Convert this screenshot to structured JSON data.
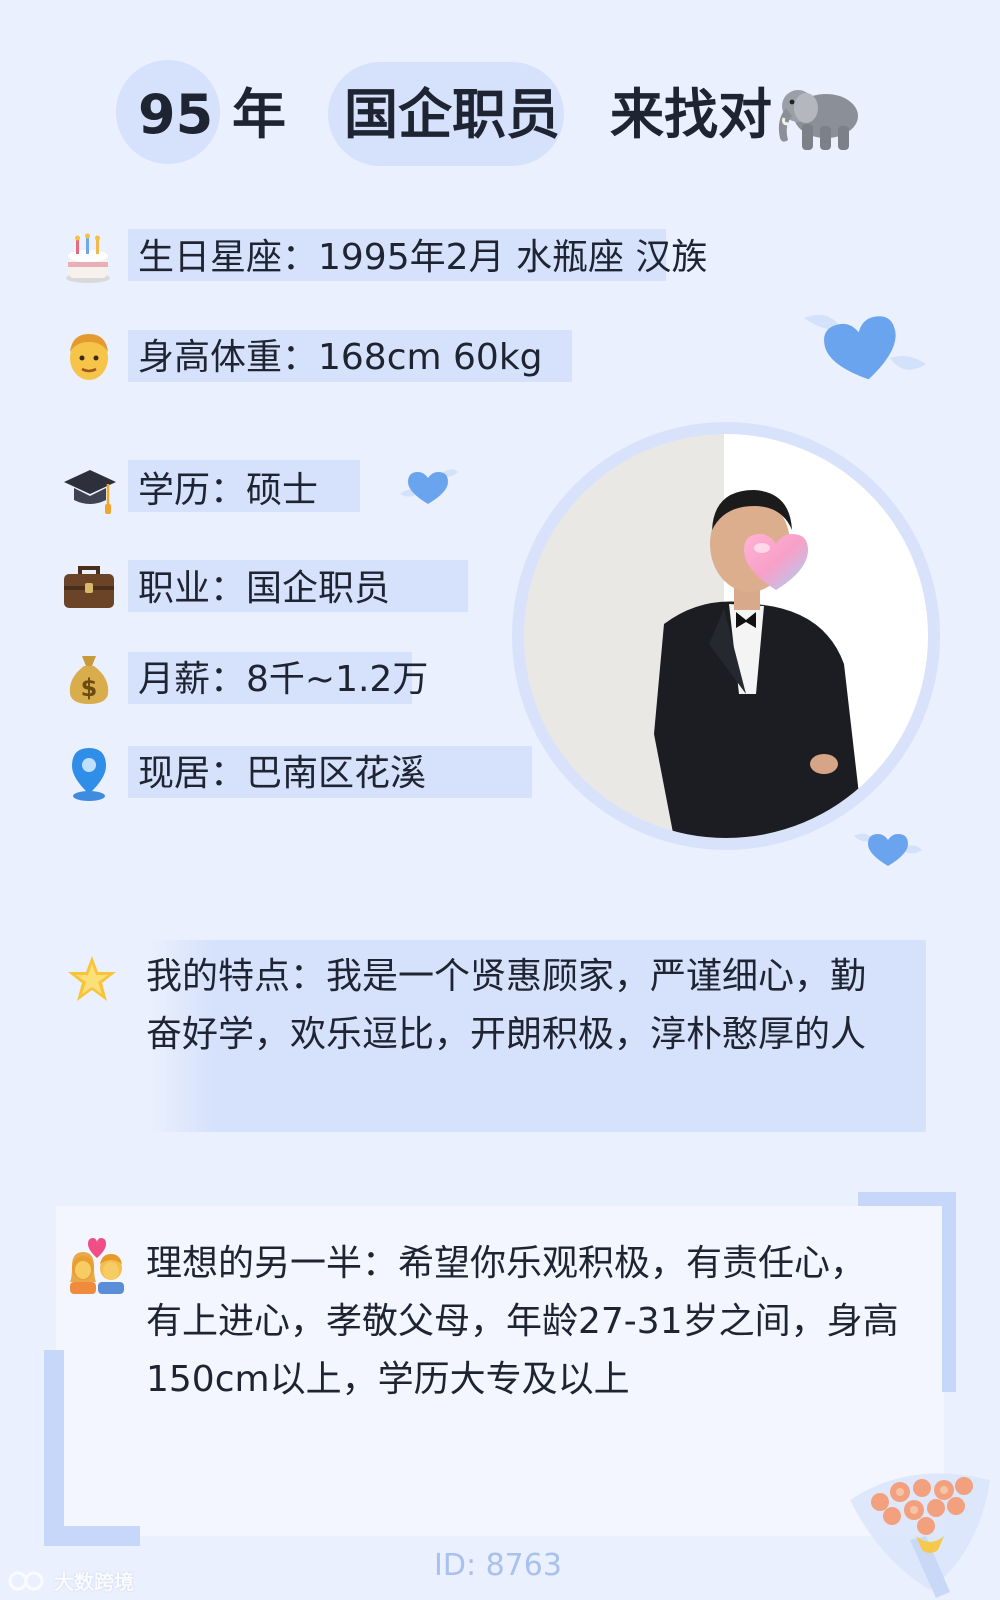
{
  "header": {
    "age": "95",
    "age_unit": "年",
    "job": "国企职员",
    "cta": "来找对",
    "cta_icon": "elephant-icon"
  },
  "profile": {
    "birthday": "生日星座：1995年2月 水瓶座 汉族",
    "height_weight": "身高体重：168cm 60kg",
    "education": "学历：硕士",
    "occupation": "职业：国企职员",
    "salary": "月薪：8千~1.2万",
    "residence": "现居：巴南区花溪"
  },
  "icons": {
    "birthday": "cake-icon",
    "height_weight": "man-face-icon",
    "education": "graduation-cap-icon",
    "occupation": "briefcase-icon",
    "salary": "money-bag-icon",
    "residence": "location-pin-icon",
    "traits": "star-icon",
    "ideal": "couple-heart-icon"
  },
  "traits": {
    "line1": "我的特点：我是一个贤惠顾家，严谨细心，勤",
    "line2": "奋好学，欢乐逗比，开朗积极，淳朴憨厚的人"
  },
  "ideal_partner": {
    "line1": "理想的另一半：希望你乐观积极，有责任心，",
    "line2": "有上进心，孝敬父母，年龄27-31岁之间，身高",
    "line3": "150cm以上，学历大专及以上"
  },
  "footer": {
    "id_text": "ID: 8763",
    "watermark": "大数跨境"
  },
  "colors": {
    "background": "#eaf0fd",
    "highlight": "#d6e2fb",
    "text": "#1f2433",
    "accent_blue": "#6aa3ee",
    "id_text": "#a9c1ee"
  }
}
